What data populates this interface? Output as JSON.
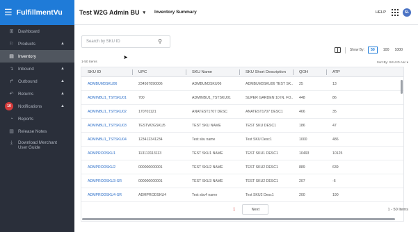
{
  "app": {
    "title": "FulfillmentVu"
  },
  "sidebar": {
    "items": [
      {
        "label": "Dashboard",
        "icon": "dashboard-icon",
        "glyph": "⊞",
        "chevron": false
      },
      {
        "label": "Products",
        "icon": "products-icon",
        "glyph": "⚐",
        "chevron": true
      },
      {
        "label": "Inventory",
        "icon": "inventory-icon",
        "glyph": "▤",
        "chevron": false,
        "active": true
      },
      {
        "label": "Inbound",
        "icon": "inbound-icon",
        "glyph": "↴",
        "chevron": true
      },
      {
        "label": "Outbound",
        "icon": "outbound-icon",
        "glyph": "↱",
        "chevron": true
      },
      {
        "label": "Returns",
        "icon": "returns-icon",
        "glyph": "↶",
        "chevron": true
      },
      {
        "label": "Notifications",
        "icon": "notifications-icon",
        "glyph": "♪",
        "chevron": true,
        "badge": "10"
      },
      {
        "label": "Reports",
        "icon": "reports-icon",
        "glyph": "◔",
        "chevron": false
      },
      {
        "label": "Release Notes",
        "icon": "release-notes-icon",
        "glyph": "▥",
        "chevron": false
      },
      {
        "label": "Download Merchant User Guide",
        "icon": "download-icon",
        "glyph": "⤓",
        "chevron": false
      }
    ]
  },
  "header": {
    "tenant": "Test W2G Admin BU",
    "page_tab": "Inventory Summary",
    "help": "HELP",
    "avatar": "SL"
  },
  "search": {
    "placeholder": "Search by SKU ID"
  },
  "toolbar": {
    "show_by": "Show By:",
    "page_sizes": [
      "50",
      "100",
      "1000"
    ],
    "selected_page_size": "50"
  },
  "items_count": "1-50 Items",
  "sort_by": "Sort By: SKU ID Asc ▾",
  "table": {
    "columns": [
      "SKU ID",
      "UPC",
      "SKU Name",
      "SKU Short Description",
      "QOH",
      "ATP"
    ],
    "rows": [
      [
        "ADMBUM3SKU06",
        "234567890006",
        "ADMBUM3SKU06",
        "ADMBUM3SKU06 TEST SK...",
        "25",
        "13"
      ],
      [
        "ADMINBU1_TSTSKU01",
        "700",
        "ADMINBU1_TSTSKU01",
        "SUPER GARDEN 10 IN. FO...",
        "448",
        "86"
      ],
      [
        "ADMINBU1_TSTSKU02",
        "170701121",
        "ANATEST1707 DESC",
        "ANATEST1707 DESC1",
        "466",
        "35"
      ],
      [
        "ADMINBU1_TSTSKU03",
        "TESTW2GSKU5",
        "TEST SKU NAME",
        "TEST SKU DESC1",
        "186",
        "47"
      ],
      [
        "ADMINBU1_TSTSKU04",
        "123412341234",
        "Test sku name",
        "Test SKU Desc1",
        "1000",
        "486"
      ],
      [
        "ADMPRODSKU1",
        "113113113113",
        "TEST SKU1 NAME",
        "TEST SKU1 DESC1",
        "10493",
        "10125"
      ],
      [
        "ADMPRODSKU2",
        "000000000001",
        "TEST SKU2 NAME",
        "TEST SKU2 DESC1",
        "889",
        "639"
      ],
      [
        "ADMPRODSKU3-SR",
        "000000000001",
        "TEST SKU3 NAME",
        "TEST SKU2 DESC1",
        "207",
        "-6"
      ],
      [
        "ADMPRODSKU4-SR",
        "ADMPRODSKU4",
        "Test sku4 name",
        "Test SKU2 Desc1",
        "200",
        "190"
      ]
    ]
  },
  "pagination": {
    "current": "1",
    "next": "Next",
    "range": "1 - 50 Items"
  }
}
